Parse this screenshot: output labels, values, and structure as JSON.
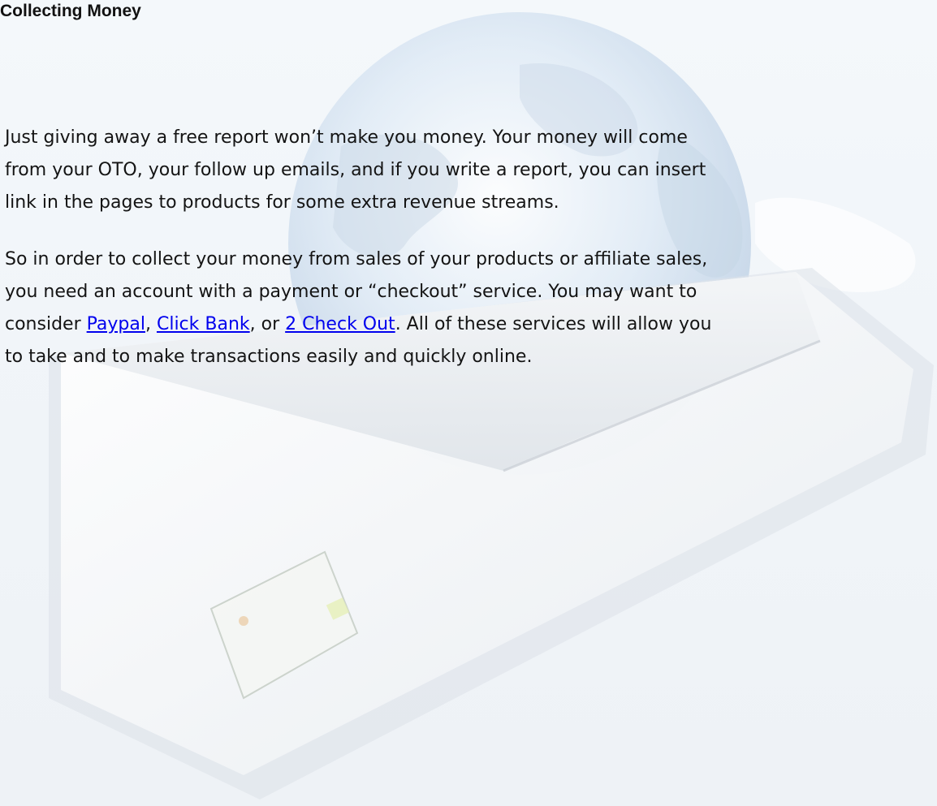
{
  "document": {
    "heading": "Collecting Money",
    "paragraph1": {
      "lines": [
        "Just giving away a free report won’t make you money. Your money will come",
        "from your OTO, your follow up emails, and if you write a report, you can insert",
        "link in the pages to products for some extra revenue streams."
      ]
    },
    "paragraph2": {
      "line1": "So in order to collect your money from sales of your products or affiliate sales,",
      "line2": "you need an account with a payment or “checkout” service. You may want to",
      "line3_prefix": "consider ",
      "link_paypal": "Paypal",
      "sep1": ", ",
      "link_clickbank": "Click Bank",
      "sep2": ", or ",
      "link_2checkout": "2 Check Out",
      "line3_suffix": ". All of these services will allow you",
      "line4": "to take and to make transactions easily and quickly online."
    }
  },
  "colors": {
    "link": "#0000ee",
    "text": "#141414",
    "background": "#f1f5f9"
  },
  "icons": {
    "watermark": "globe-envelope-watermark"
  }
}
